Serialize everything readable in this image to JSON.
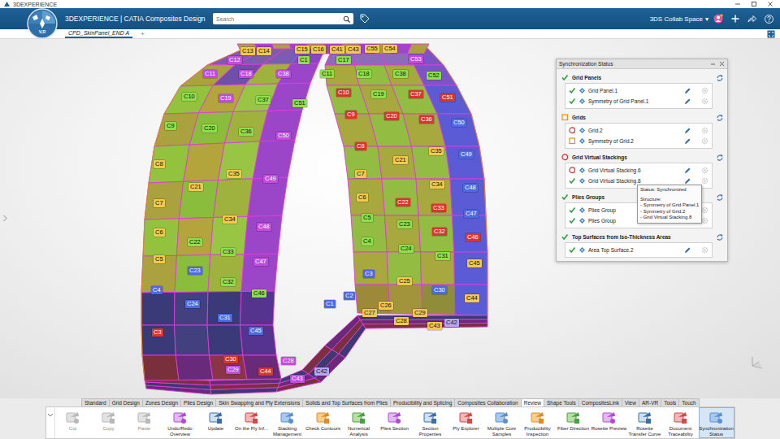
{
  "app": {
    "window_title": "3DEXPERIENCE",
    "logo_sub": "V,R",
    "brand": "3DEXPERIENCE | CATIA Composites Design",
    "collab_space": "3DS Collab Space",
    "collab_caret": "▾"
  },
  "search": {
    "placeholder": "Search"
  },
  "doc_tabs": [
    {
      "label": "CPD_SkinPanel_END A",
      "selected": true
    }
  ],
  "new_tab": "+",
  "model": {
    "labels": [
      {
        "text": "C13",
        "color": "#f2c94c"
      },
      {
        "text": "C14",
        "color": "#f2c94c"
      },
      {
        "text": "C15",
        "color": "#f2c94c"
      },
      {
        "text": "C16",
        "color": "#f2c94c"
      },
      {
        "text": "C41",
        "color": "#f2c94c"
      },
      {
        "text": "C43",
        "color": "#f2c94c"
      },
      {
        "text": "C55",
        "color": "#f2c94c"
      },
      {
        "text": "C54",
        "color": "#f2c94c"
      },
      {
        "text": "C12",
        "color": "#c04ce0"
      },
      {
        "text": "C1",
        "color": "#8ee04a"
      },
      {
        "text": "C17",
        "color": "#8ee04a"
      },
      {
        "text": "C53",
        "color": "#c04ce0"
      },
      {
        "text": "C11",
        "color": "#c04ce0"
      },
      {
        "text": "C18",
        "color": "#c04ce0"
      },
      {
        "text": "C38",
        "color": "#c04ce0"
      },
      {
        "text": "C11",
        "color": "#8ee04a"
      },
      {
        "text": "C18",
        "color": "#8ee04a"
      },
      {
        "text": "C38",
        "color": "#8ee04a"
      },
      {
        "text": "C52",
        "color": "#8ee04a"
      },
      {
        "text": "C10",
        "color": "#8ee04a"
      },
      {
        "text": "C19",
        "color": "#c04ce0"
      },
      {
        "text": "C37",
        "color": "#8ee04a"
      },
      {
        "text": "C51",
        "color": "#8ee04a"
      },
      {
        "text": "C10",
        "color": "#d9362f"
      },
      {
        "text": "C19",
        "color": "#8ee04a"
      },
      {
        "text": "C37",
        "color": "#d9362f"
      },
      {
        "text": "C51",
        "color": "#d9362f"
      },
      {
        "text": "C9",
        "color": "#8ee04a"
      },
      {
        "text": "C20",
        "color": "#8ee04a"
      },
      {
        "text": "C36",
        "color": "#8ee04a"
      },
      {
        "text": "C50",
        "color": "#c04ce0"
      },
      {
        "text": "C9",
        "color": "#d9362f"
      },
      {
        "text": "C20",
        "color": "#d9362f"
      },
      {
        "text": "C36",
        "color": "#d9362f"
      },
      {
        "text": "C50",
        "color": "#4d6be0"
      },
      {
        "text": "C8",
        "color": "#f2c94c"
      },
      {
        "text": "C35",
        "color": "#f2c94c"
      },
      {
        "text": "C49",
        "color": "#c04ce0"
      },
      {
        "text": "C8",
        "color": "#d9362f"
      },
      {
        "text": "C21",
        "color": "#f2c94c"
      },
      {
        "text": "C35",
        "color": "#f2c94c"
      },
      {
        "text": "C49",
        "color": "#4d6be0"
      },
      {
        "text": "C21",
        "color": "#f2c94c"
      },
      {
        "text": "C7",
        "color": "#f2c94c"
      },
      {
        "text": "C34",
        "color": "#f2c94c"
      },
      {
        "text": "C48",
        "color": "#4d6be0"
      },
      {
        "text": "C7",
        "color": "#f2c94c"
      },
      {
        "text": "C6",
        "color": "#f2c94c"
      },
      {
        "text": "C22",
        "color": "#d9362f"
      },
      {
        "text": "C33",
        "color": "#d9362f"
      },
      {
        "text": "C47",
        "color": "#4d6be0"
      },
      {
        "text": "C34",
        "color": "#f2c94c"
      },
      {
        "text": "C48",
        "color": "#c04ce0"
      },
      {
        "text": "C5",
        "color": "#8ee04a"
      },
      {
        "text": "C23",
        "color": "#8ee04a"
      },
      {
        "text": "C32",
        "color": "#d9362f"
      },
      {
        "text": "C46",
        "color": "#d9362f"
      },
      {
        "text": "C6",
        "color": "#f2c94c"
      },
      {
        "text": "C22",
        "color": "#8ee04a"
      },
      {
        "text": "C4",
        "color": "#8ee04a"
      },
      {
        "text": "C24",
        "color": "#8ee04a"
      },
      {
        "text": "C33",
        "color": "#8ee04a"
      },
      {
        "text": "C31",
        "color": "#8ee04a"
      },
      {
        "text": "C5",
        "color": "#f2c94c"
      },
      {
        "text": "C47",
        "color": "#c04ce0"
      },
      {
        "text": "C45",
        "color": "#f2c94c"
      },
      {
        "text": "C23",
        "color": "#4d6be0"
      },
      {
        "text": "C3",
        "color": "#4d6be0"
      },
      {
        "text": "C25",
        "color": "#f2c94c"
      },
      {
        "text": "C32",
        "color": "#8ee04a"
      },
      {
        "text": "C4",
        "color": "#4d6be0"
      },
      {
        "text": "C30",
        "color": "#4d6be0"
      },
      {
        "text": "C46",
        "color": "#8ee04a"
      },
      {
        "text": "C2",
        "color": "#4d6be0"
      },
      {
        "text": "C44",
        "color": "#f2c94c"
      },
      {
        "text": "C24",
        "color": "#4d6be0"
      },
      {
        "text": "C1",
        "color": "#4d6be0"
      },
      {
        "text": "C26",
        "color": "#f2c94c"
      },
      {
        "text": "C27",
        "color": "#f2c94c"
      },
      {
        "text": "C29",
        "color": "#f2c94c"
      },
      {
        "text": "C31",
        "color": "#4d6be0"
      },
      {
        "text": "C28",
        "color": "#f2c94c"
      },
      {
        "text": "C42",
        "color": "#b9a6f0"
      },
      {
        "text": "C43",
        "color": "#f2c94c"
      },
      {
        "text": "C45",
        "color": "#4d6be0"
      },
      {
        "text": "C3",
        "color": "#d9362f"
      },
      {
        "text": "C30",
        "color": "#d9362f"
      },
      {
        "text": "C28",
        "color": "#c04ce0"
      },
      {
        "text": "C29",
        "color": "#c04ce0"
      },
      {
        "text": "C44",
        "color": "#d9362f"
      },
      {
        "text": "C42",
        "color": "#b9a6f0"
      },
      {
        "text": "C43",
        "color": "#c04ce0"
      }
    ]
  },
  "sync_panel": {
    "title": "Synchronization Status",
    "sections": [
      {
        "title": "Grid Panels",
        "status": "ok",
        "items": [
          {
            "label": "Grid Panel.1",
            "status": "ok"
          },
          {
            "label": "Symmetry of Grid Panel.1",
            "status": "ok"
          }
        ]
      },
      {
        "title": "Grids",
        "status": "warning",
        "items": [
          {
            "label": "Grid.2",
            "status": "error"
          },
          {
            "label": "Symmetry of Grid.2",
            "status": "warning"
          }
        ]
      },
      {
        "title": "Grid Virtual Stackings",
        "status": "error",
        "items": [
          {
            "label": "Grid Virtual Stacking.6",
            "status": "error"
          },
          {
            "label": "Grid Virtual Stacking.8",
            "status": "ok",
            "tooltip": {
              "title": "Status: Synchronized",
              "subtitle": "Structure:",
              "lines": [
                "- Symmetry of Grid Panel.1",
                "- Symmetry of Grid.2",
                "- Grid Virtual Stacking.8"
              ]
            }
          }
        ]
      },
      {
        "title": "Plies Groups",
        "status": "ok",
        "items": [
          {
            "label": "Plies Group",
            "status": "ok"
          },
          {
            "label": "Plies Group",
            "status": "ok"
          }
        ]
      },
      {
        "title": "Top Surfaces from Iso-Thickness Areas",
        "status": "ok",
        "items": [
          {
            "label": "Area Top Surface.2",
            "status": "ok"
          }
        ]
      }
    ]
  },
  "ribbon_tabs": [
    {
      "label": "Standard",
      "selected": false
    },
    {
      "label": "Grid Design",
      "selected": false
    },
    {
      "label": "Zones Design",
      "selected": false
    },
    {
      "label": "Plies Design",
      "selected": false
    },
    {
      "label": "Skin Swapping and Ply Extensions",
      "selected": false
    },
    {
      "label": "Solids and Top Surfaces from Plies",
      "selected": false
    },
    {
      "label": "Producibility and Splicing",
      "selected": false
    },
    {
      "label": "Composites Collaboration",
      "selected": false
    },
    {
      "label": "Review",
      "selected": true
    },
    {
      "label": "Shape Tools",
      "selected": false
    },
    {
      "label": "CompositesLink",
      "selected": false
    },
    {
      "label": "View",
      "selected": false
    },
    {
      "label": "AR-VR",
      "selected": false
    },
    {
      "label": "Tools",
      "selected": false
    },
    {
      "label": "Touch",
      "selected": false
    }
  ],
  "toolbar": [
    {
      "label": "Cut",
      "disabled": true,
      "selected": false
    },
    {
      "label": "Copy",
      "disabled": true,
      "selected": false
    },
    {
      "label": "Paste",
      "disabled": true,
      "selected": false
    },
    {
      "label": "Undo/Redo Overview",
      "disabled": false,
      "selected": false
    },
    {
      "label": "Update",
      "disabled": false,
      "selected": false
    },
    {
      "label": "On the Fly Inf...",
      "disabled": false,
      "selected": false
    },
    {
      "label": "Stacking Management",
      "disabled": false,
      "selected": false
    },
    {
      "label": "Check Contours",
      "disabled": false,
      "selected": false
    },
    {
      "label": "Numerical Analysis",
      "disabled": false,
      "selected": false
    },
    {
      "label": "Plies Section",
      "disabled": false,
      "selected": false
    },
    {
      "label": "Section Properties",
      "disabled": false,
      "selected": false
    },
    {
      "label": "Ply Explorer",
      "disabled": false,
      "selected": false
    },
    {
      "label": "Multiple Core Samples",
      "disabled": false,
      "selected": false
    },
    {
      "label": "Producibility Inspection",
      "disabled": false,
      "selected": false
    },
    {
      "label": "Fiber Direction",
      "disabled": false,
      "selected": false
    },
    {
      "label": "Rosette Preview",
      "disabled": false,
      "selected": false
    },
    {
      "label": "Rosette Transfer Curve",
      "disabled": false,
      "selected": false
    },
    {
      "label": "Document Traceability",
      "disabled": false,
      "selected": false
    },
    {
      "label": "Synchronization Status",
      "disabled": false,
      "selected": true
    }
  ]
}
